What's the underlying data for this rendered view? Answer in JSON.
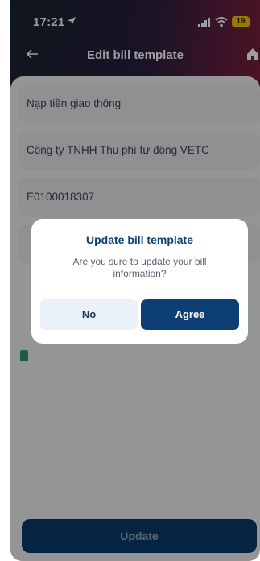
{
  "status_bar": {
    "time": "17:21",
    "battery": "19"
  },
  "header": {
    "title": "Edit bill template",
    "back_icon": "arrow-left-icon",
    "home_icon": "home-icon"
  },
  "form": {
    "service": "Nạp tiền giao thông",
    "provider": "Công ty TNHH Thu phí tự động VETC",
    "customer_code": "E0100018307"
  },
  "footer": {
    "update_label": "Update"
  },
  "dialog": {
    "title": "Update bill template",
    "message": "Are you sure to update your bill information?",
    "no_label": "No",
    "agree_label": "Agree"
  },
  "colors": {
    "primary": "#0d3f75",
    "overlay": "rgba(0,0,0,0.38)"
  }
}
